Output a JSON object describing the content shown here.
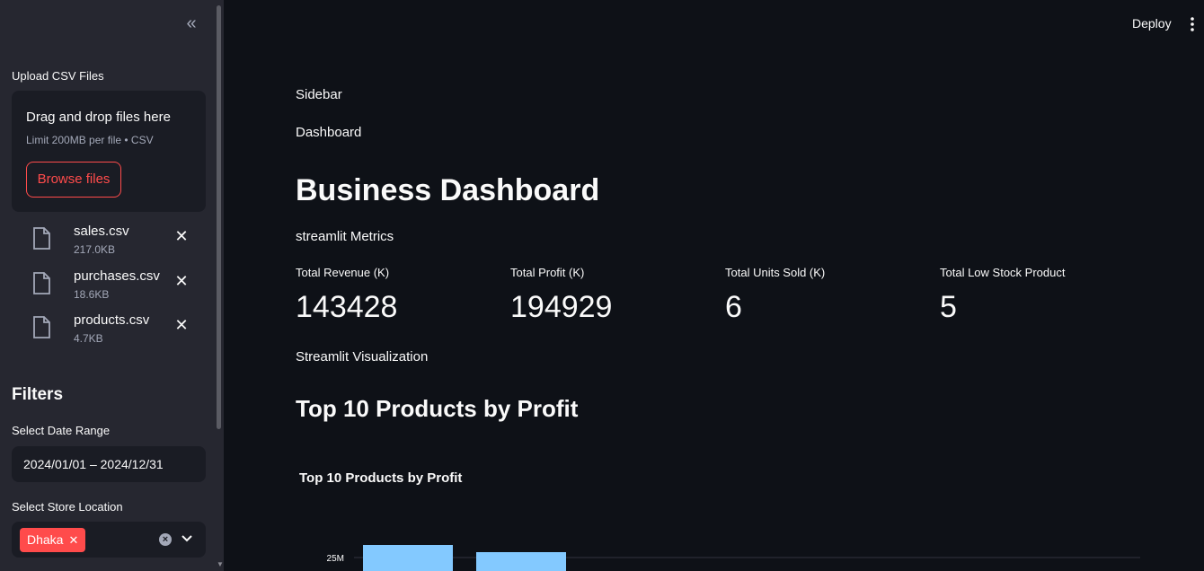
{
  "sidebar": {
    "upload_label": "Upload CSV Files",
    "uploader": {
      "title": "Drag and drop files here",
      "limit": "Limit 200MB per file • CSV",
      "browse_label": "Browse files"
    },
    "files": [
      {
        "name": "sales.csv",
        "size": "217.0KB"
      },
      {
        "name": "purchases.csv",
        "size": "18.6KB"
      },
      {
        "name": "products.csv",
        "size": "4.7KB"
      }
    ],
    "filters_title": "Filters",
    "date_label": "Select Date Range",
    "date_value": "2024/01/01 – 2024/12/31",
    "store_label": "Select Store Location",
    "store_selected": "Dhaka"
  },
  "header": {
    "deploy_label": "Deploy"
  },
  "main": {
    "text_sidebar": "Sidebar",
    "text_dashboard": "Dashboard",
    "title": "Business Dashboard",
    "metrics_caption": "streamlit Metrics",
    "metrics": [
      {
        "label": "Total Revenue (K)",
        "value": "143428"
      },
      {
        "label": "Total Profit (K)",
        "value": "194929"
      },
      {
        "label": "Total Units Sold (K)",
        "value": "6"
      },
      {
        "label": "Total Low Stock Product",
        "value": "5"
      }
    ],
    "viz_caption": "Streamlit Visualization",
    "chart_heading": "Top 10 Products by Profit"
  },
  "chart_data": {
    "type": "bar",
    "title": "Top 10 Products by Profit",
    "y_tick_labels": [
      "25M"
    ],
    "y_tick_value": 25,
    "bar_color": "#83c9ff",
    "values_visible_partial": [
      26.4,
      25.6
    ]
  },
  "colors": {
    "accent": "#ff4b4b",
    "background": "#0e1117",
    "sidebar_bg": "#262730",
    "bar": "#83c9ff"
  }
}
